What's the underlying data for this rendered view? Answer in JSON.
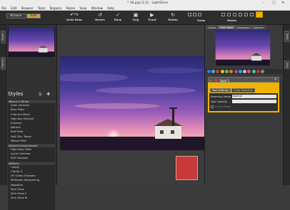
{
  "titlebar": {
    "title": "* 18.jpg (1:3) - LightZone",
    "min": "–",
    "max": "□",
    "close": "✕"
  },
  "menu": [
    "File",
    "Edit",
    "Browser",
    "Tools",
    "Regions",
    "Styles",
    "View",
    "Window",
    "Help"
  ],
  "toolbar": {
    "browse": "Browse",
    "edit": "Edit",
    "tools": [
      {
        "label": "Undo Redo",
        "icon": "↶↷"
      },
      {
        "label": "Revert",
        "icon": "↺"
      },
      {
        "label": "Done",
        "icon": "✓"
      },
      {
        "label": "Orig",
        "icon": "▣"
      },
      {
        "label": "Proof",
        "icon": "▶"
      },
      {
        "label": "Rotate",
        "icon": "↻"
      }
    ],
    "zoom_label": "Zoom",
    "modes_label": "Modes"
  },
  "left_tabs": [
    "Styles",
    "History"
  ],
  "right_tabs": [
    "Tools",
    "Info"
  ],
  "styles": {
    "title": "Styles",
    "groups": [
      {
        "name": "Black & White",
        "items": [
          "Alien Infrared",
          "Blue Filter",
          "Channel Mixer",
          "High Key Portrait",
          "Infrared",
          "Normal",
          "Red Filter",
          "Soft Skin Tones",
          "Yellow Filter"
        ]
      },
      {
        "name": "Detail Enhancement",
        "items": [
          "High-Pass Filter",
          "Local Contrast",
          "SLR Sharpen"
        ]
      },
      {
        "name": "Effects",
        "items": [
          "Clarity",
          "Clarity II",
          "HF Green Sharpen",
          "Midtones Sharpening",
          "Negative",
          "Skin Glow",
          "Skin Glow II",
          "Skin Glow III"
        ]
      }
    ]
  },
  "nav_tabs": [
    "Zones",
    "Color Mask",
    "Histogram",
    "Sampler"
  ],
  "nav_active": "Color Mask",
  "layer": {
    "name": "Spot 1"
  },
  "subtabs": [
    "Tool Settings",
    "Color Selection"
  ],
  "props": {
    "blending_label": "Blending Mode",
    "blending_value": "Normal",
    "opacity_label": "Tool Opacity",
    "invert_label": "Invert Mask"
  },
  "colors": {
    "accent": "#f0b400",
    "swatch": "#c83a3a"
  }
}
